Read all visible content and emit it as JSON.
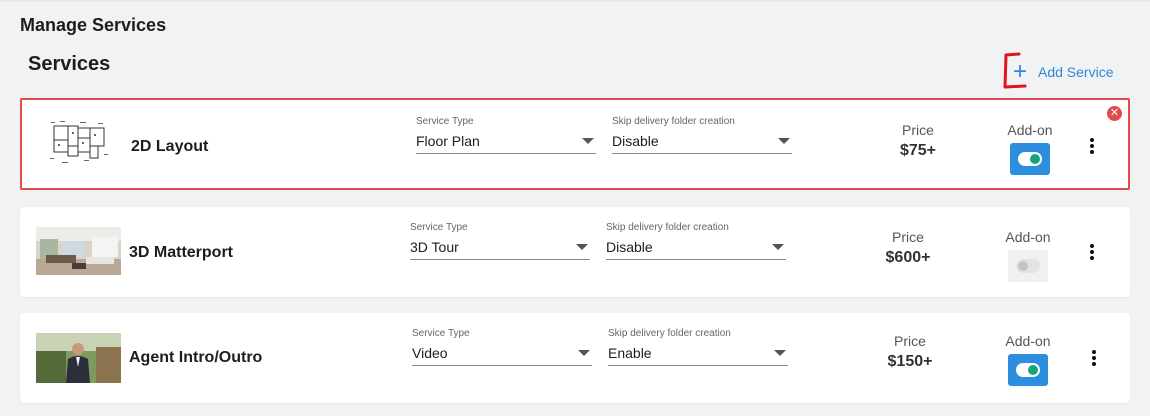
{
  "page_title": "Manage Services",
  "section_title": "Services",
  "add_service_label": "Add Service",
  "close_glyph": "✕",
  "colors": {
    "accent": "#2f86d8",
    "selected_border": "#e04b4b",
    "toggle_on": "#2d8ee0",
    "knob_on": "#15a37a"
  },
  "services": [
    {
      "name": "2D Layout",
      "thumbnail": "floor-plan-thumbnail",
      "service_type_label": "Service Type",
      "service_type_value": "Floor Plan",
      "skip_label": "Skip delivery folder creation",
      "skip_value": "Disable",
      "price_label": "Price",
      "price_value": "$75+",
      "addon_label": "Add-on",
      "addon_enabled": true,
      "selected": true
    },
    {
      "name": "3D Matterport",
      "thumbnail": "interior-photo-thumbnail",
      "service_type_label": "Service Type",
      "service_type_value": "3D Tour",
      "skip_label": "Skip delivery folder creation",
      "skip_value": "Disable",
      "price_label": "Price",
      "price_value": "$600+",
      "addon_label": "Add-on",
      "addon_enabled": false,
      "selected": false
    },
    {
      "name": "Agent Intro/Outro",
      "thumbnail": "agent-photo-thumbnail",
      "service_type_label": "Service Type",
      "service_type_value": "Video",
      "skip_label": "Skip delivery folder creation",
      "skip_value": "Enable",
      "price_label": "Price",
      "price_value": "$150+",
      "addon_label": "Add-on",
      "addon_enabled": true,
      "selected": false
    }
  ]
}
